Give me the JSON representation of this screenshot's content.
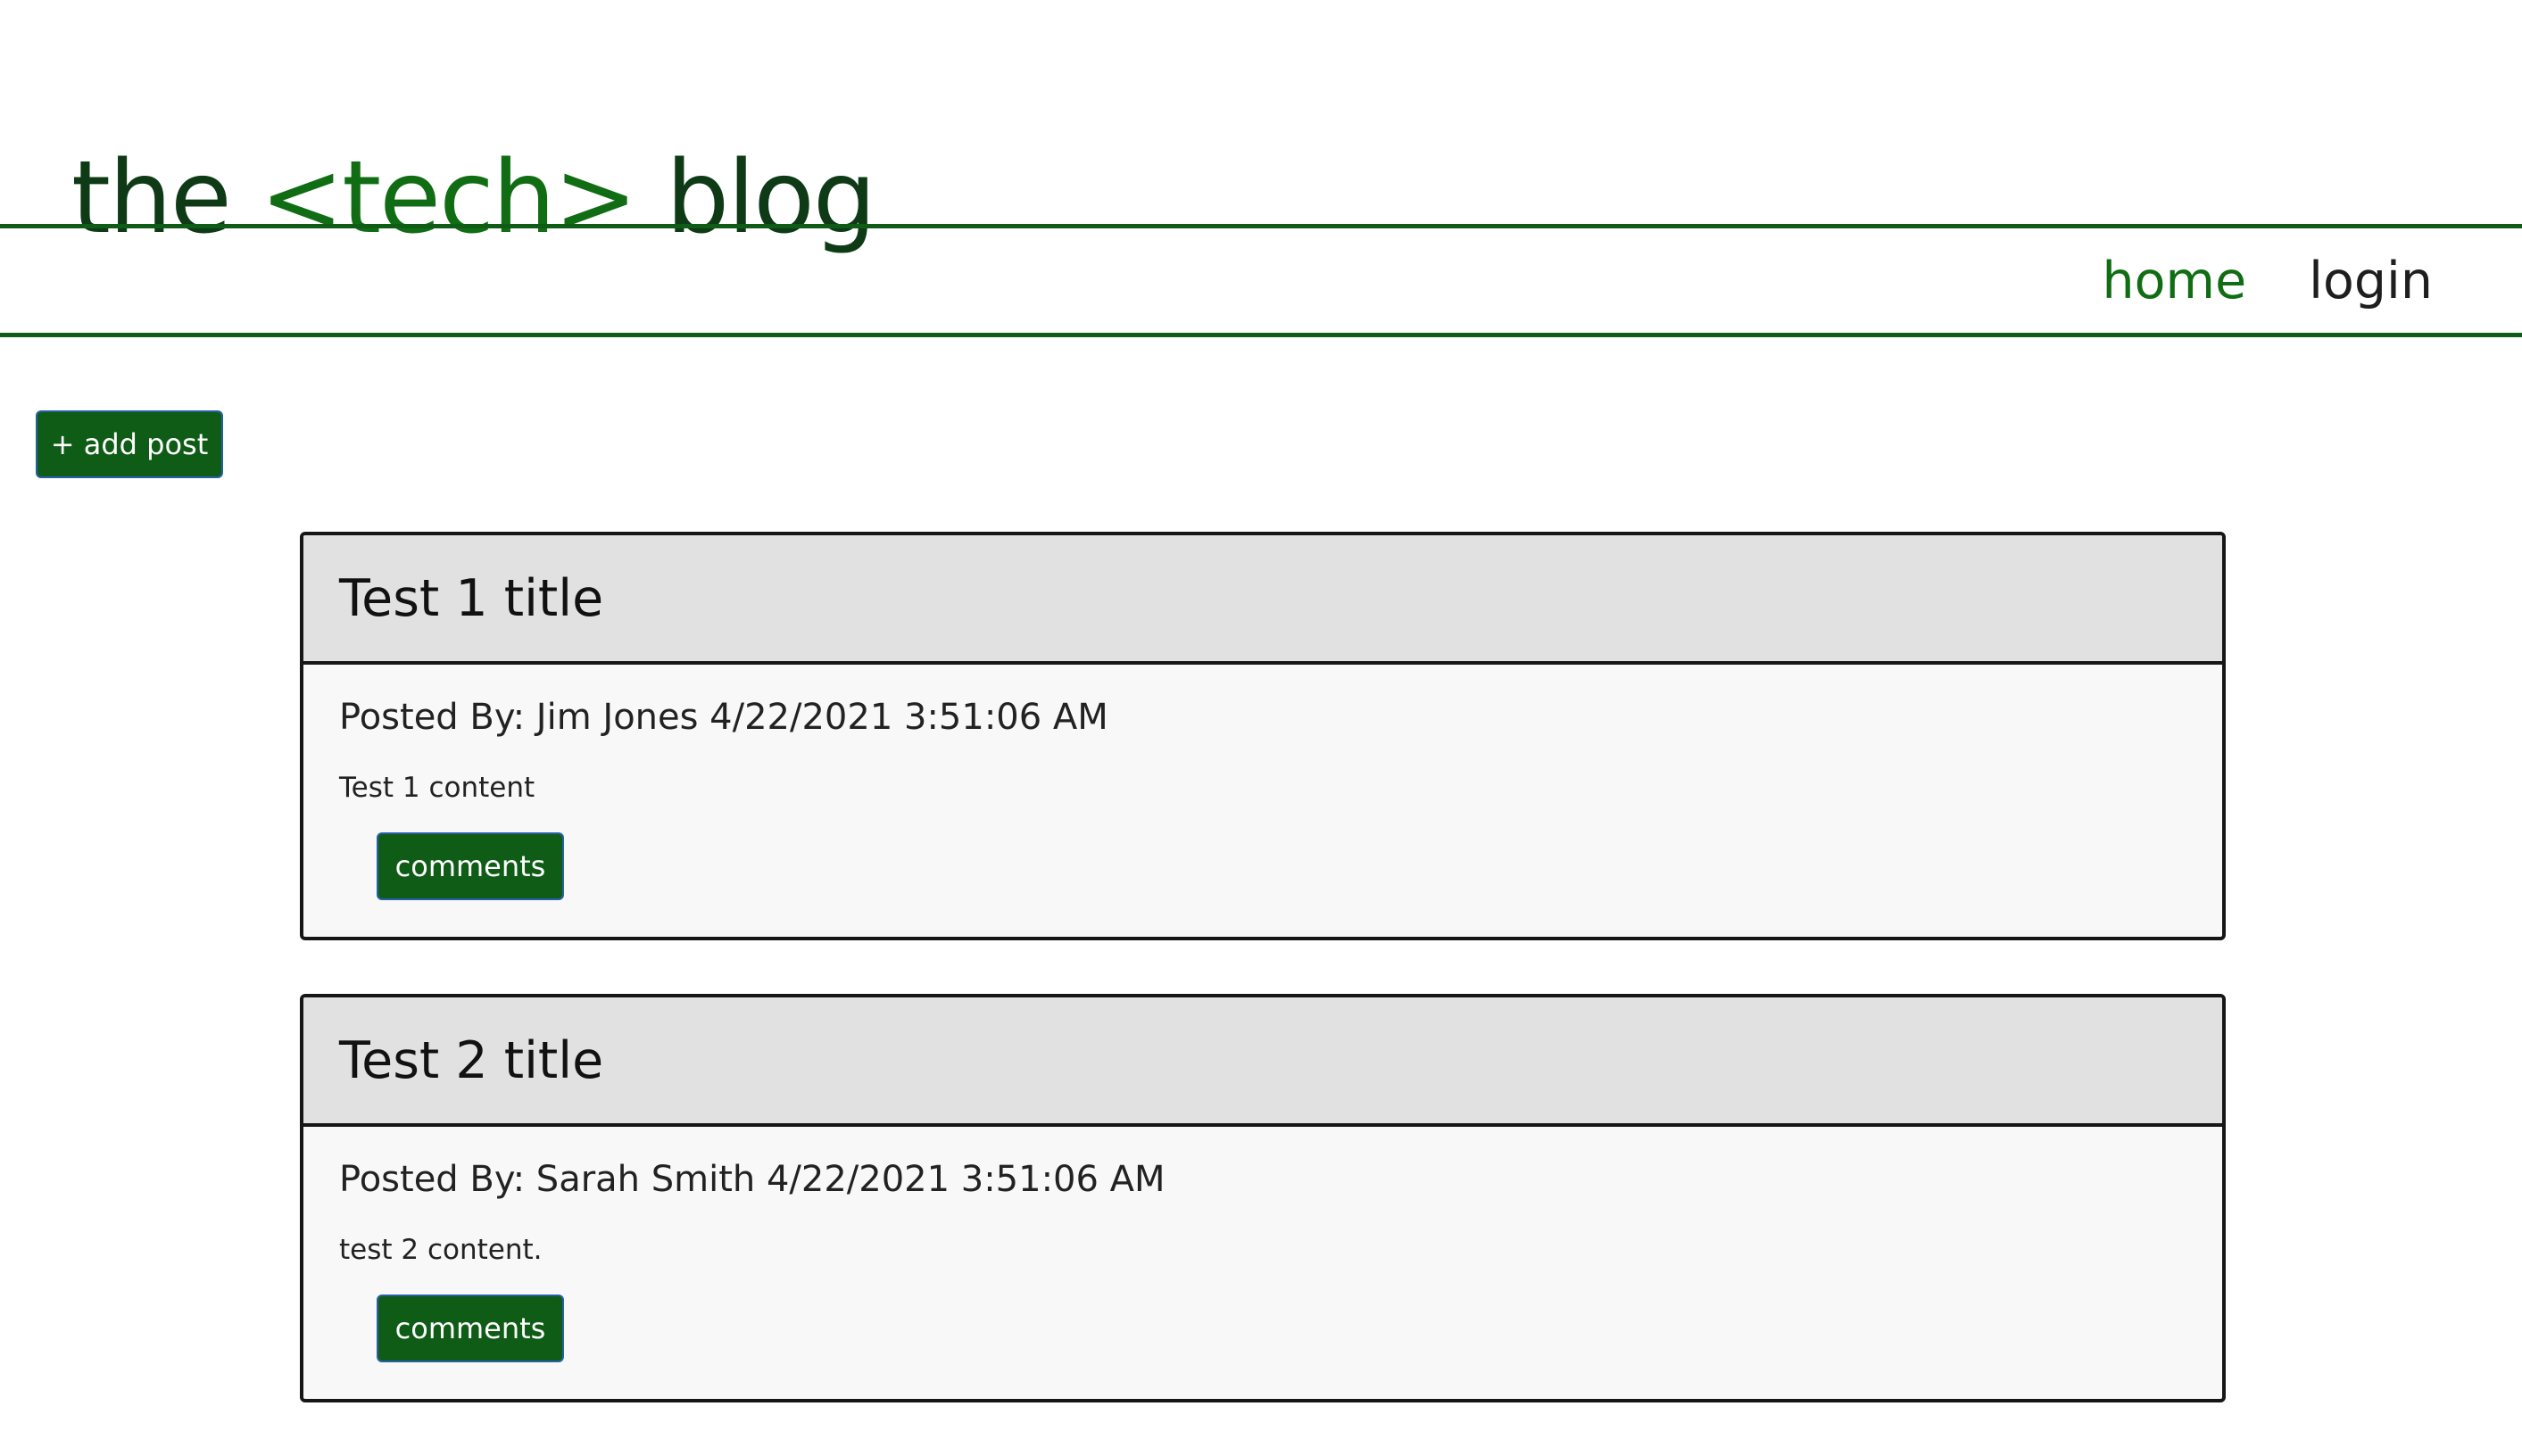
{
  "header": {
    "brand_prefix": "the ",
    "brand_accent": "<tech>",
    "brand_suffix": " blog"
  },
  "nav": {
    "home_label": "home",
    "login_label": "login"
  },
  "actions": {
    "add_post_label": "+ add post"
  },
  "posts": [
    {
      "title": "Test 1 title",
      "meta": "Posted By: Jim Jones 4/22/2021 3:51:06 AM",
      "content": "Test 1 content",
      "comments_label": "comments"
    },
    {
      "title": "Test 2 title",
      "meta": "Posted By: Sarah Smith 4/22/2021 3:51:06 AM",
      "content": "test 2 content.",
      "comments_label": "comments"
    }
  ],
  "colors": {
    "brand_green": "#116d13",
    "button_green": "#0f5c16",
    "card_header": "#e1e1e1",
    "card_body": "#f8f8f8"
  }
}
